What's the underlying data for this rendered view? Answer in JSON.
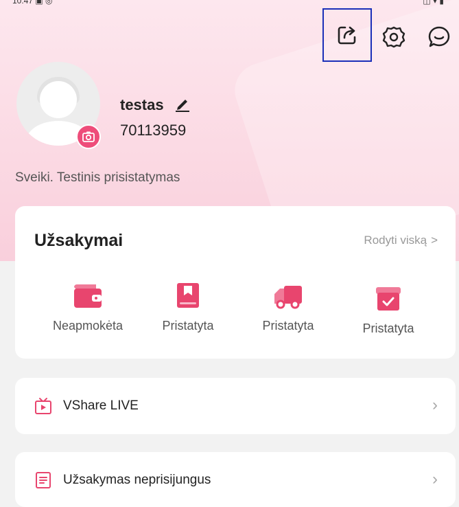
{
  "status": {
    "left": "10:47 ▣ ◎",
    "right": "◫ ▾ ▮"
  },
  "icons": {
    "share": "share-icon",
    "settings": "gear-icon",
    "chat": "chat-bubble-icon",
    "camera": "camera-icon",
    "edit": "pencil-icon"
  },
  "profile": {
    "username": "testas",
    "user_id": "70113959",
    "bio": "Sveiki. Testinis prisistatymas"
  },
  "orders": {
    "title": "Užsakymai",
    "show_all": "Rodyti viską",
    "items": [
      {
        "label": "Neapmokėta",
        "icon": "wallet-icon"
      },
      {
        "label": "Pristatyta",
        "icon": "package-icon"
      },
      {
        "label": "Pristatyta",
        "icon": "truck-icon"
      },
      {
        "label": "Pristatyta",
        "icon": "box-check-icon"
      }
    ]
  },
  "menu": [
    {
      "label": "VShare LIVE",
      "icon": "tv-play-icon"
    },
    {
      "label": "Užsakymas neprisijungus",
      "icon": "document-icon"
    }
  ],
  "colors": {
    "accent": "#ee4d7a",
    "highlight_border": "#1a2fb8"
  }
}
